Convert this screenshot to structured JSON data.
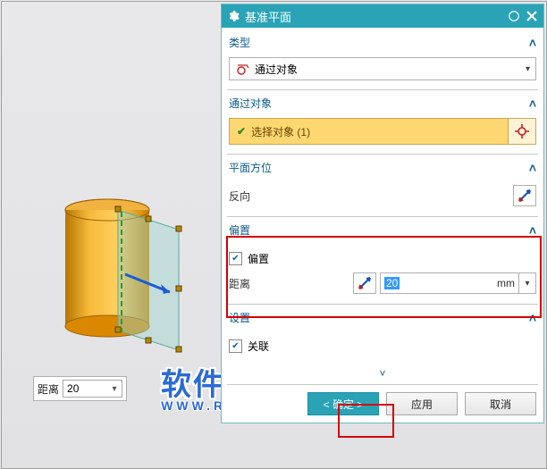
{
  "dialog": {
    "title": "基准平面",
    "sections": {
      "type": {
        "header": "类型",
        "value": "通过对象"
      },
      "through_object": {
        "header": "通过对象",
        "select_label": "选择对象 (1)"
      },
      "plane_orient": {
        "header": "平面方位",
        "reverse_label": "反向"
      },
      "offset": {
        "header": "偏置",
        "checkbox_label": "偏置",
        "distance_label": "距离",
        "distance_value": "20",
        "distance_unit": "mm"
      },
      "settings": {
        "header": "设置",
        "assoc_label": "关联"
      }
    },
    "buttons": {
      "ok": "< 确定 >",
      "apply": "应用",
      "cancel": "取消"
    }
  },
  "float_distance": {
    "label": "距离",
    "value": "20"
  },
  "watermark": {
    "line1": "软件自学网",
    "line2": "WWW.RJZXW.COM"
  }
}
